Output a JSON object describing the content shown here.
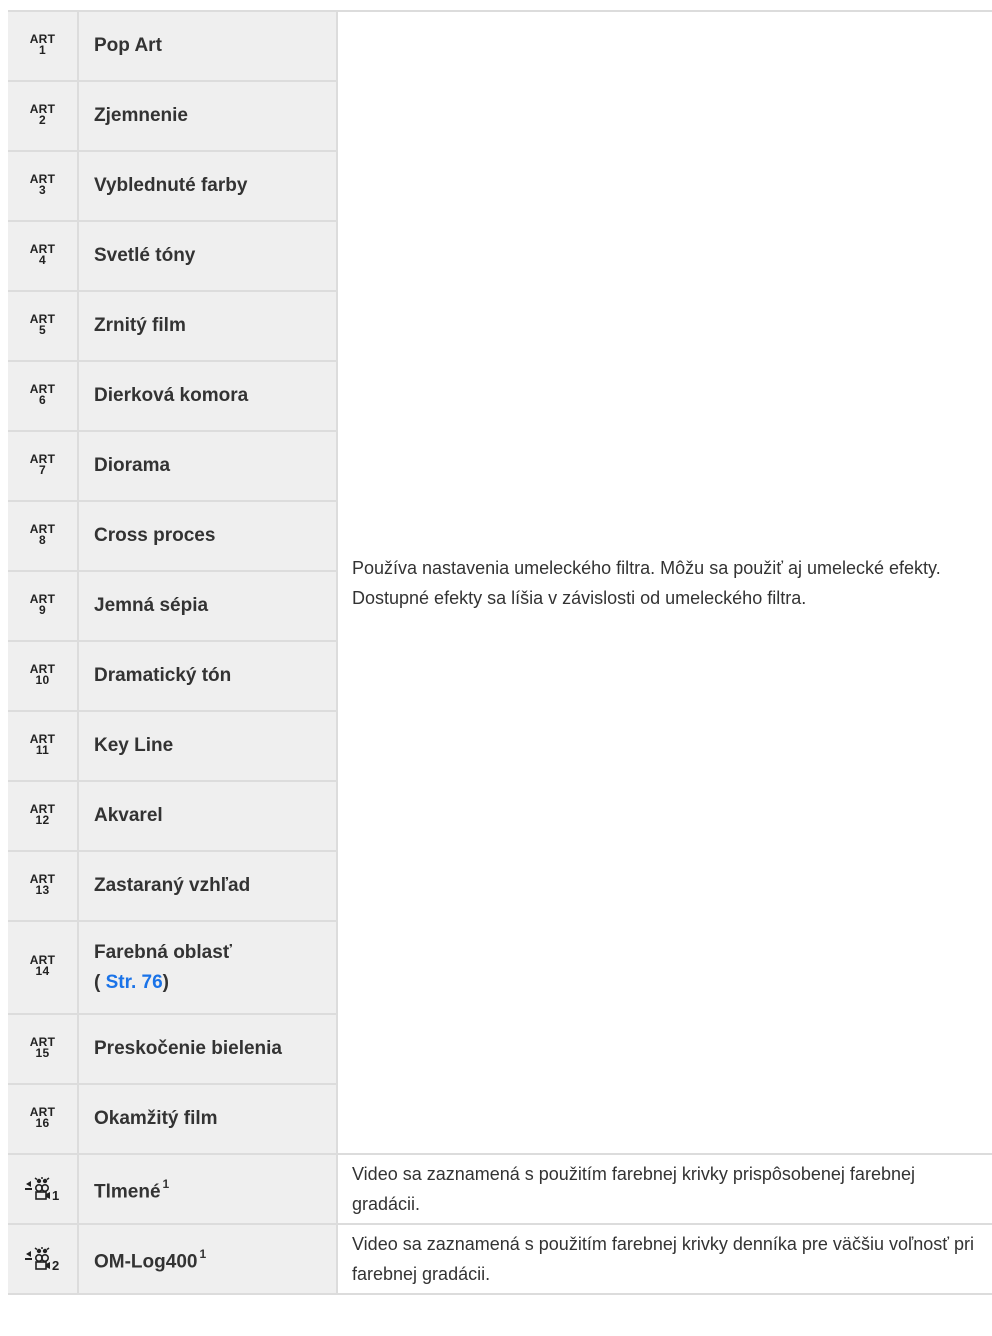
{
  "art_filters": [
    {
      "badge_top": "ART",
      "badge_num": "1",
      "name": "Pop Art"
    },
    {
      "badge_top": "ART",
      "badge_num": "2",
      "name": "Zjemnenie"
    },
    {
      "badge_top": "ART",
      "badge_num": "3",
      "name": "Vyblednuté farby"
    },
    {
      "badge_top": "ART",
      "badge_num": "4",
      "name": "Svetlé tóny"
    },
    {
      "badge_top": "ART",
      "badge_num": "5",
      "name": "Zrnitý film"
    },
    {
      "badge_top": "ART",
      "badge_num": "6",
      "name": "Dierková komora"
    },
    {
      "badge_top": "ART",
      "badge_num": "7",
      "name": "Diorama"
    },
    {
      "badge_top": "ART",
      "badge_num": "8",
      "name": "Cross proces"
    },
    {
      "badge_top": "ART",
      "badge_num": "9",
      "name": "Jemná sépia"
    },
    {
      "badge_top": "ART",
      "badge_num": "10",
      "name": "Dramatický tón"
    },
    {
      "badge_top": "ART",
      "badge_num": "11",
      "name": "Key Line"
    },
    {
      "badge_top": "ART",
      "badge_num": "12",
      "name": "Akvarel"
    },
    {
      "badge_top": "ART",
      "badge_num": "13",
      "name": "Zastaraný vzhľad"
    },
    {
      "badge_top": "ART",
      "badge_num": "14",
      "name": "Farebná oblasť",
      "link_open": "( ",
      "link_text": "Str. 76",
      "link_close": ")"
    },
    {
      "badge_top": "ART",
      "badge_num": "15",
      "name": "Preskočenie bielenia"
    },
    {
      "badge_top": "ART",
      "badge_num": "16",
      "name": "Okamžitý film"
    }
  ],
  "art_description": "Používa nastavenia umeleckého filtra. Môžu sa použiť aj umelecké efekty. Dostupné efekty sa líšia v závislosti od umeleckého filtra.",
  "video_modes": [
    {
      "icon": "video-picture-mode-icon",
      "icon_num": "1",
      "name": "Tlmené",
      "sup": "1",
      "description": "Video sa zaznamená s použitím farebnej krivky prispôsobenej farebnej gradácii."
    },
    {
      "icon": "video-picture-mode-icon",
      "icon_num": "2",
      "name": "OM-Log400",
      "sup": "1",
      "description": "Video sa zaznamená s použitím farebnej krivky denníka pre väčšiu voľnosť pri farebnej gradácii."
    }
  ],
  "colors": {
    "header_bg": "#efefef",
    "border": "#dcdcdc",
    "link": "#1a73e8",
    "text": "#333333"
  }
}
